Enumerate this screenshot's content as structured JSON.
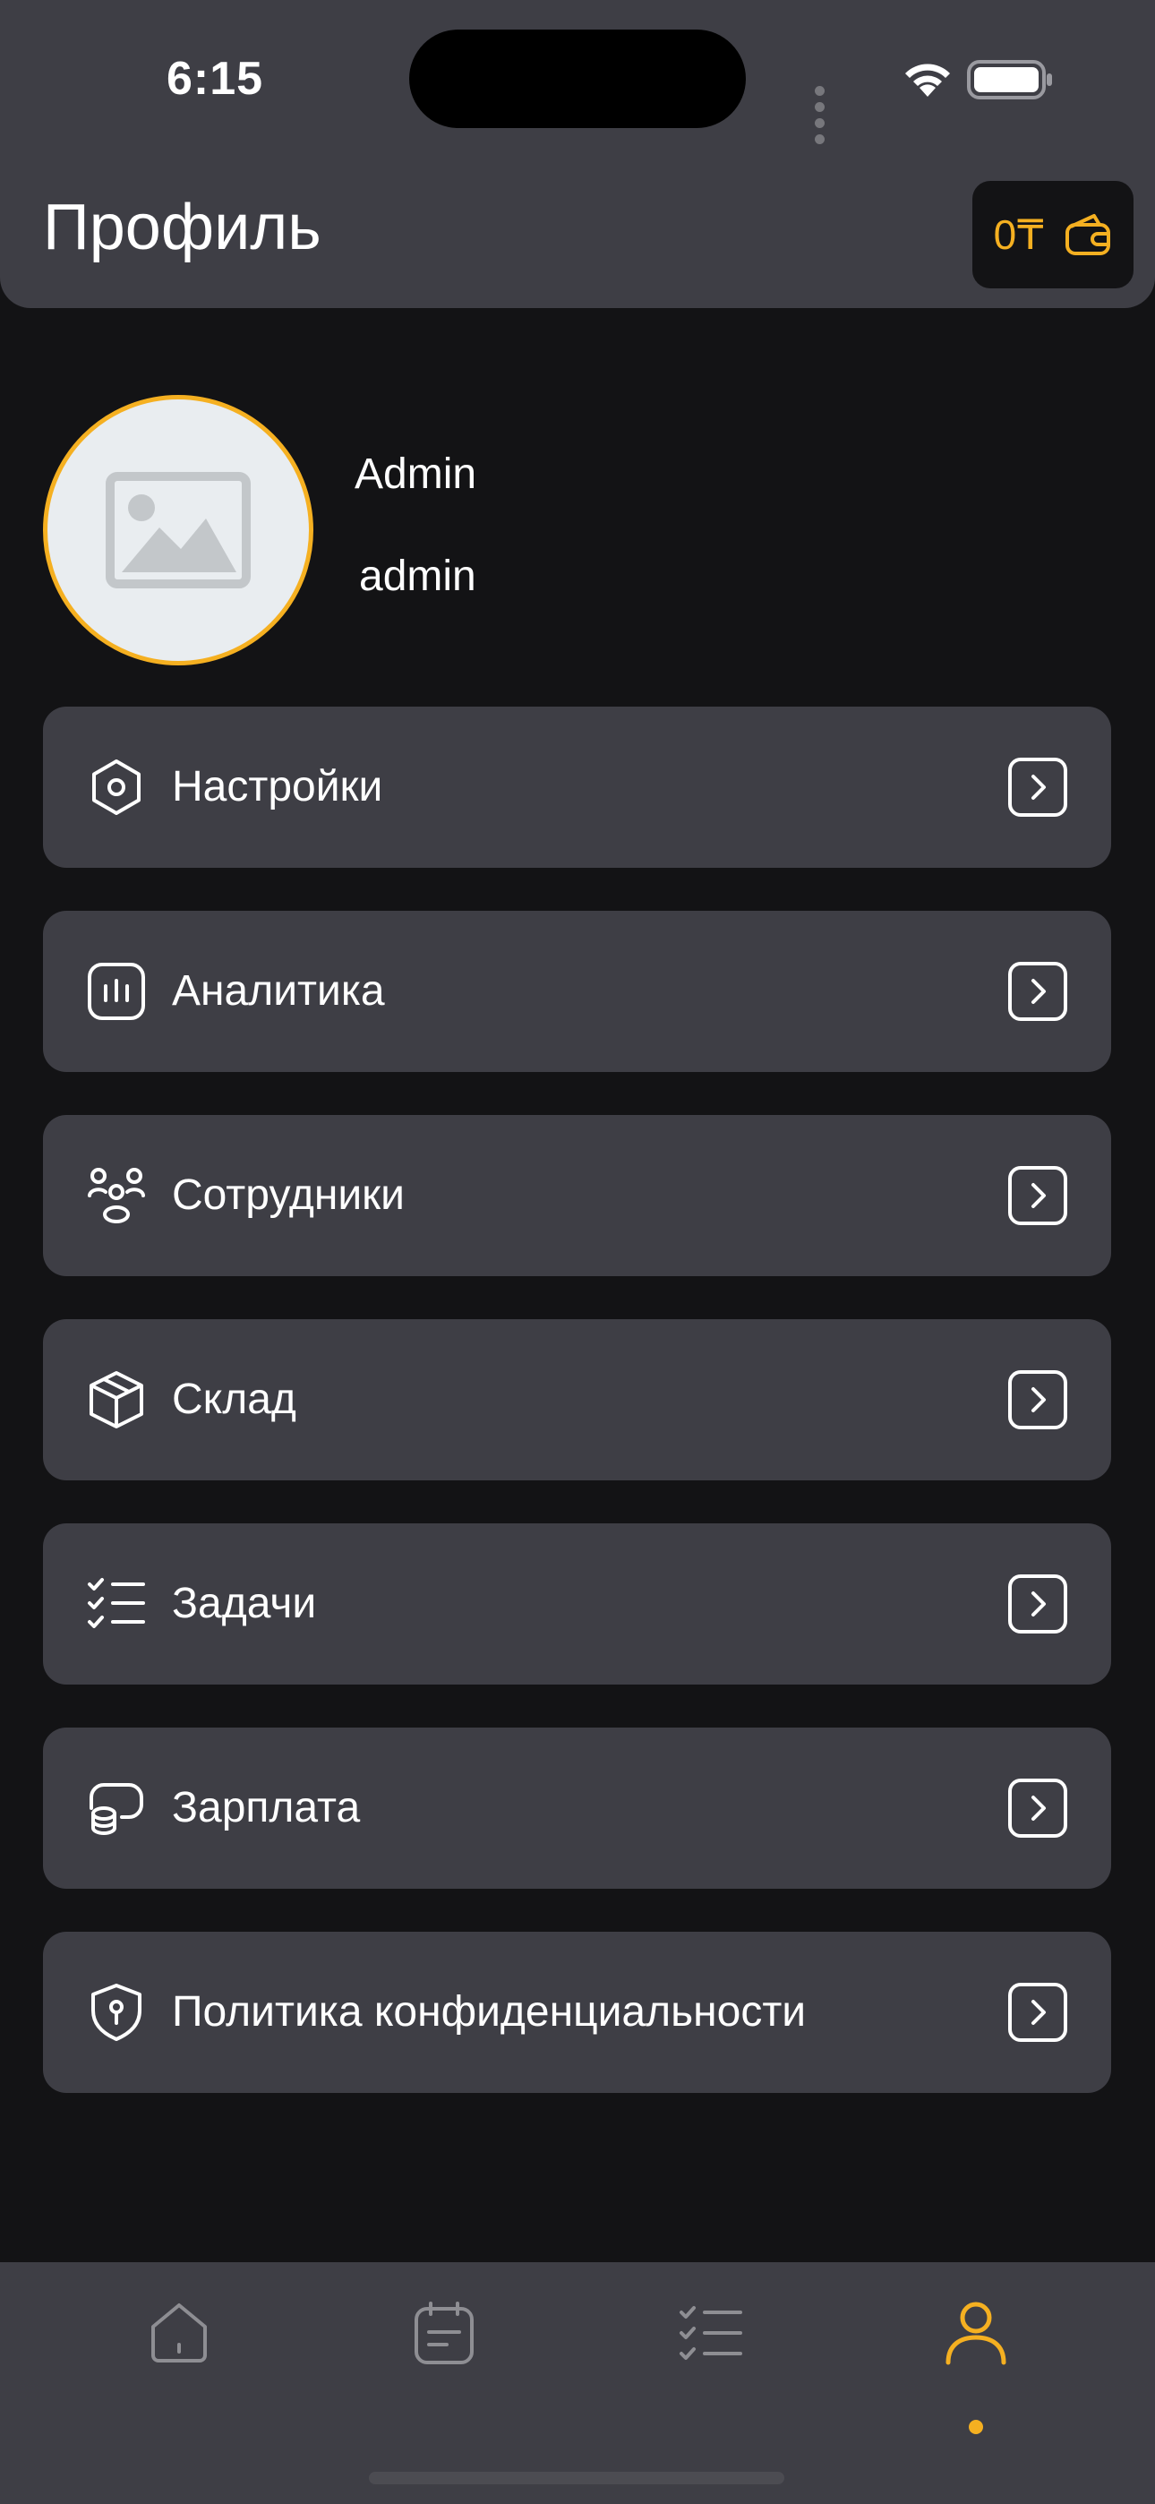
{
  "status_bar": {
    "time": "6:15"
  },
  "header": {
    "title": "Профиль",
    "wallet_amount": "0₸"
  },
  "profile": {
    "name": "Admin",
    "login": "admin"
  },
  "menu": {
    "items": [
      {
        "label": "Настройки",
        "icon": "settings-hexagon-icon"
      },
      {
        "label": "Аналитика",
        "icon": "analytics-icon"
      },
      {
        "label": "Сотрудники",
        "icon": "employees-icon"
      },
      {
        "label": "Склад",
        "icon": "box-icon"
      },
      {
        "label": "Задачи",
        "icon": "task-list-icon"
      },
      {
        "label": "Зарплата",
        "icon": "coins-icon"
      },
      {
        "label": "Политика конфиденциальности",
        "icon": "shield-icon"
      }
    ]
  },
  "tabbar": {
    "active": "profile",
    "tabs": [
      "home-icon",
      "calendar-notes-icon",
      "task-list-icon",
      "profile-icon"
    ]
  },
  "colors": {
    "accent": "#f5b021",
    "card": "#3e3e45",
    "background": "#131315",
    "muted_icon": "#8e8e93"
  }
}
